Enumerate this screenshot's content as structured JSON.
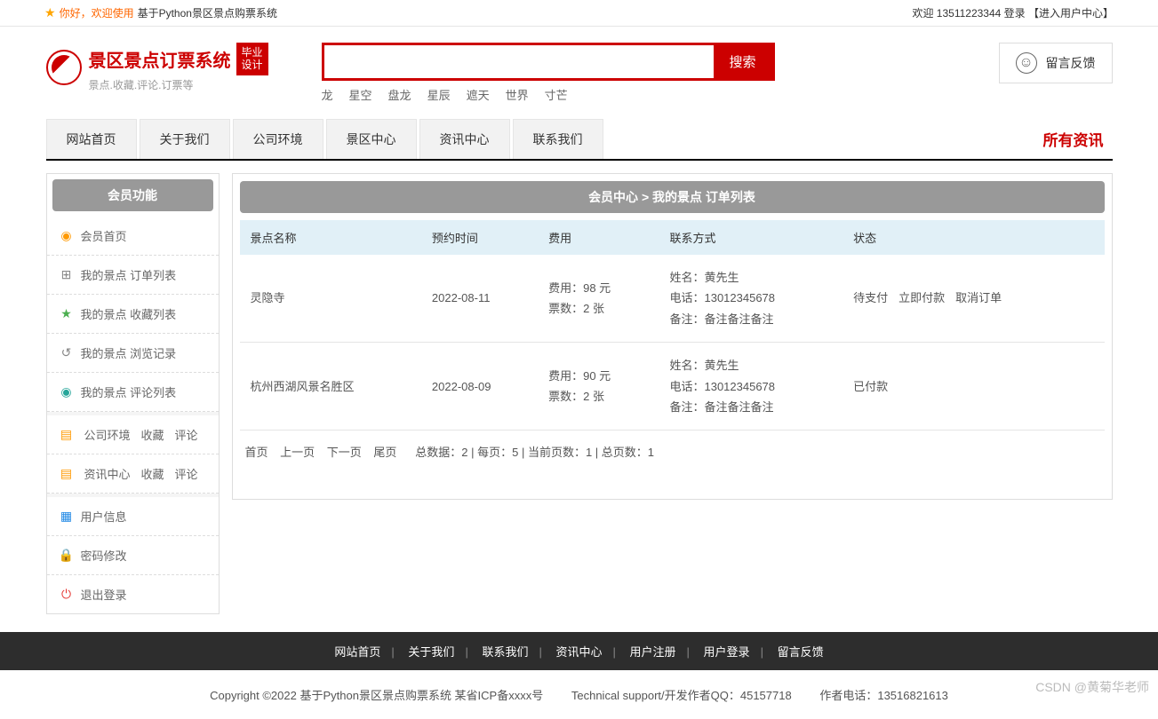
{
  "topbar": {
    "welcome_prefix": "你好，欢迎使用",
    "site_name": "基于Python景区景点购票系统",
    "welcome_right": "欢迎 13511223344 登录 【进入用户中心】"
  },
  "logo": {
    "title": "景区景点订票系统",
    "subtitle": "景点.收藏.评论.订票等",
    "badge_line1": "毕业",
    "badge_line2": "设计"
  },
  "search": {
    "button": "搜索",
    "hotwords": [
      "龙",
      "星空",
      "盘龙",
      "星辰",
      "遮天",
      "世界",
      "寸芒"
    ]
  },
  "feedback_label": "留言反馈",
  "nav": [
    "网站首页",
    "关于我们",
    "公司环境",
    "景区中心",
    "资讯中心",
    "联系我们"
  ],
  "all_news": "所有资讯",
  "sidebar": {
    "title": "会员功能",
    "items": [
      {
        "label": "会员首页",
        "icon": "◉",
        "cls": "ic-orange"
      },
      {
        "label": "我的景点 订单列表",
        "icon": "⊞",
        "cls": "ic-gray"
      },
      {
        "label": "我的景点 收藏列表",
        "icon": "★",
        "cls": "ic-green"
      },
      {
        "label": "我的景点 浏览记录",
        "icon": "↺",
        "cls": "ic-gray"
      },
      {
        "label": "我的景点 评论列表",
        "icon": "◉",
        "cls": "ic-teal"
      }
    ],
    "items2": [
      {
        "main": "公司环境",
        "a": "收藏",
        "b": "评论",
        "icon": "▤",
        "cls": "ic-orange"
      },
      {
        "main": "资讯中心",
        "a": "收藏",
        "b": "评论",
        "icon": "▤",
        "cls": "ic-orange"
      }
    ],
    "items3": [
      {
        "label": "用户信息",
        "icon": "▦",
        "cls": "ic-blue"
      },
      {
        "label": "密码修改",
        "icon": "🔒",
        "cls": "ic-orange"
      },
      {
        "label": "退出登录",
        "icon": "⏻",
        "cls": "ic-red"
      }
    ]
  },
  "content": {
    "title": "会员中心 > 我的景点 订单列表",
    "headers": [
      "景点名称",
      "预约时间",
      "费用",
      "联系方式",
      "状态"
    ],
    "rows": [
      {
        "name": "灵隐寺",
        "date": "2022-08-11",
        "fee_l1": "费用：98 元",
        "fee_l2": "票数：2 张",
        "c_l1": "姓名：黄先生",
        "c_l2": "电话：13012345678",
        "c_l3": "备注：备注备注备注",
        "status": "待支付",
        "act1": "立即付款",
        "act2": "取消订单"
      },
      {
        "name": "杭州西湖风景名胜区",
        "date": "2022-08-09",
        "fee_l1": "费用：90 元",
        "fee_l2": "票数：2 张",
        "c_l1": "姓名：黄先生",
        "c_l2": "电话：13012345678",
        "c_l3": "备注：备注备注备注",
        "status": "已付款",
        "act1": "",
        "act2": ""
      }
    ],
    "pager": {
      "first": "首页",
      "prev": "上一页",
      "next": "下一页",
      "last": "尾页",
      "info": "总数据：2 | 每页：5 | 当前页数：1 | 总页数：1"
    }
  },
  "footer": {
    "nav": [
      "网站首页",
      "关于我们",
      "联系我们",
      "资讯中心",
      "用户注册",
      "用户登录",
      "留言反馈"
    ],
    "copyright": "Copyright ©2022 基于Python景区景点购票系统 某省ICP备xxxx号",
    "support": "Technical support/开发作者QQ：45157718",
    "author": "作者电话：13516821613"
  },
  "watermark": "CSDN @黄菊华老师"
}
